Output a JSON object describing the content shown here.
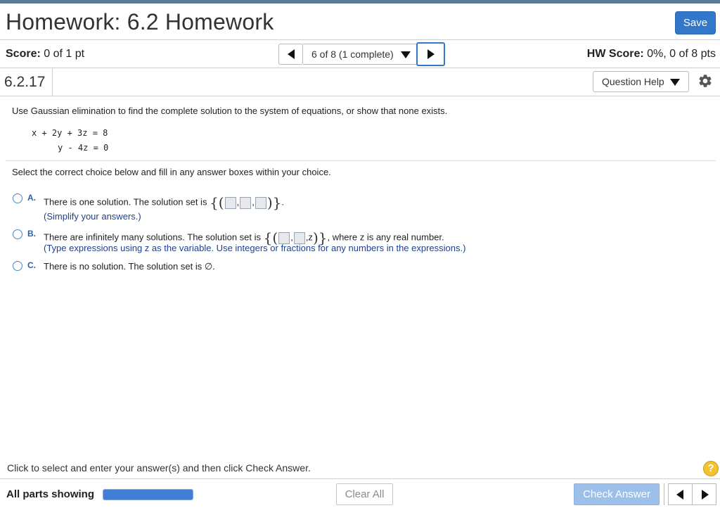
{
  "header": {
    "title": "Homework: 6.2 Homework",
    "save_label": "Save"
  },
  "score_bar": {
    "score_label": "Score:",
    "score_value": "0 of 1 pt",
    "question_nav": "6 of 8 (1 complete)",
    "hw_score_label": "HW Score:",
    "hw_score_value": "0%, 0 of 8 pts"
  },
  "question": {
    "number": "6.2.17",
    "help_label": "Question Help",
    "prompt": "Use Gaussian elimination to find the complete solution to the system of equations, or show that none exists.",
    "equations": [
      "x + 2y + 3z = 8",
      "y - 4z = 0"
    ],
    "instruction": "Select the correct choice below and fill in any answer boxes within your choice.",
    "choices": [
      {
        "letter": "A.",
        "text_before": "There is one solution. The solution set is",
        "brace_open": "{(",
        "brace_close": ")}",
        "period": ".",
        "hint": "(Simplify your answers.)"
      },
      {
        "letter": "B.",
        "text_before": "There are infinitely many solutions. The solution set is",
        "brace_open": "{(",
        "var_z": ",z",
        "brace_close": ")}",
        "text_after": ", where z is any real number.",
        "hint": "(Type expressions using z as the variable. Use integers or fractions for any numbers in the expressions.)"
      },
      {
        "letter": "C.",
        "text": "There is no solution. The solution set is ∅."
      }
    ]
  },
  "footer": {
    "message": "Click to select and enter your answer(s) and then click Check Answer.",
    "help_symbol": "?",
    "parts_label": "All parts showing",
    "progress_fraction": 1.0,
    "clear_label": "Clear All",
    "check_label": "Check Answer"
  },
  "colors": {
    "accent": "#3277c9",
    "hint_text": "#1f3f8f",
    "help_badge": "#f2c230"
  }
}
